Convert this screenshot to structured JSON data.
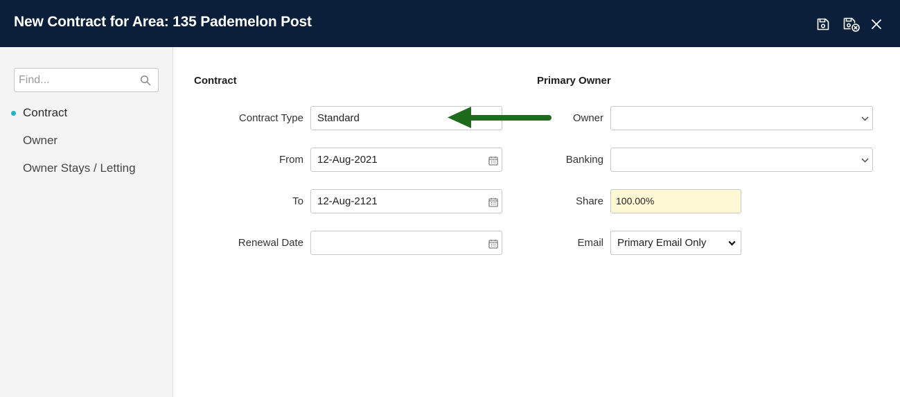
{
  "header": {
    "title": "New Contract for Area: 135 Pademelon Post"
  },
  "icons": {
    "save": "save-icon",
    "save_close": "save-close-icon",
    "close": "close-icon",
    "search": "search-icon",
    "calendar": "calendar-icon",
    "chevron": "chevron-down-icon",
    "arrow": "green-arrow-annotation"
  },
  "colors": {
    "header_bg": "#0b1f3a",
    "active_dot": "#1fb3c7",
    "share_bg": "#fef8d4",
    "arrow": "#1e6b1e"
  },
  "sidebar": {
    "search_placeholder": "Find...",
    "items": [
      {
        "label": "Contract",
        "active": true
      },
      {
        "label": "Owner",
        "active": false
      },
      {
        "label": "Owner Stays / Letting",
        "active": false
      }
    ]
  },
  "contract": {
    "section_title": "Contract",
    "contract_type": {
      "label": "Contract Type",
      "value": "Standard"
    },
    "from": {
      "label": "From",
      "value": "12-Aug-2021"
    },
    "to": {
      "label": "To",
      "value": "12-Aug-2121"
    },
    "renewal_date": {
      "label": "Renewal Date",
      "value": ""
    }
  },
  "primary_owner": {
    "section_title": "Primary Owner",
    "owner": {
      "label": "Owner",
      "value": ""
    },
    "banking": {
      "label": "Banking",
      "value": ""
    },
    "share": {
      "label": "Share",
      "value": "100.00%"
    },
    "email": {
      "label": "Email",
      "value": "Primary Email Only"
    }
  }
}
